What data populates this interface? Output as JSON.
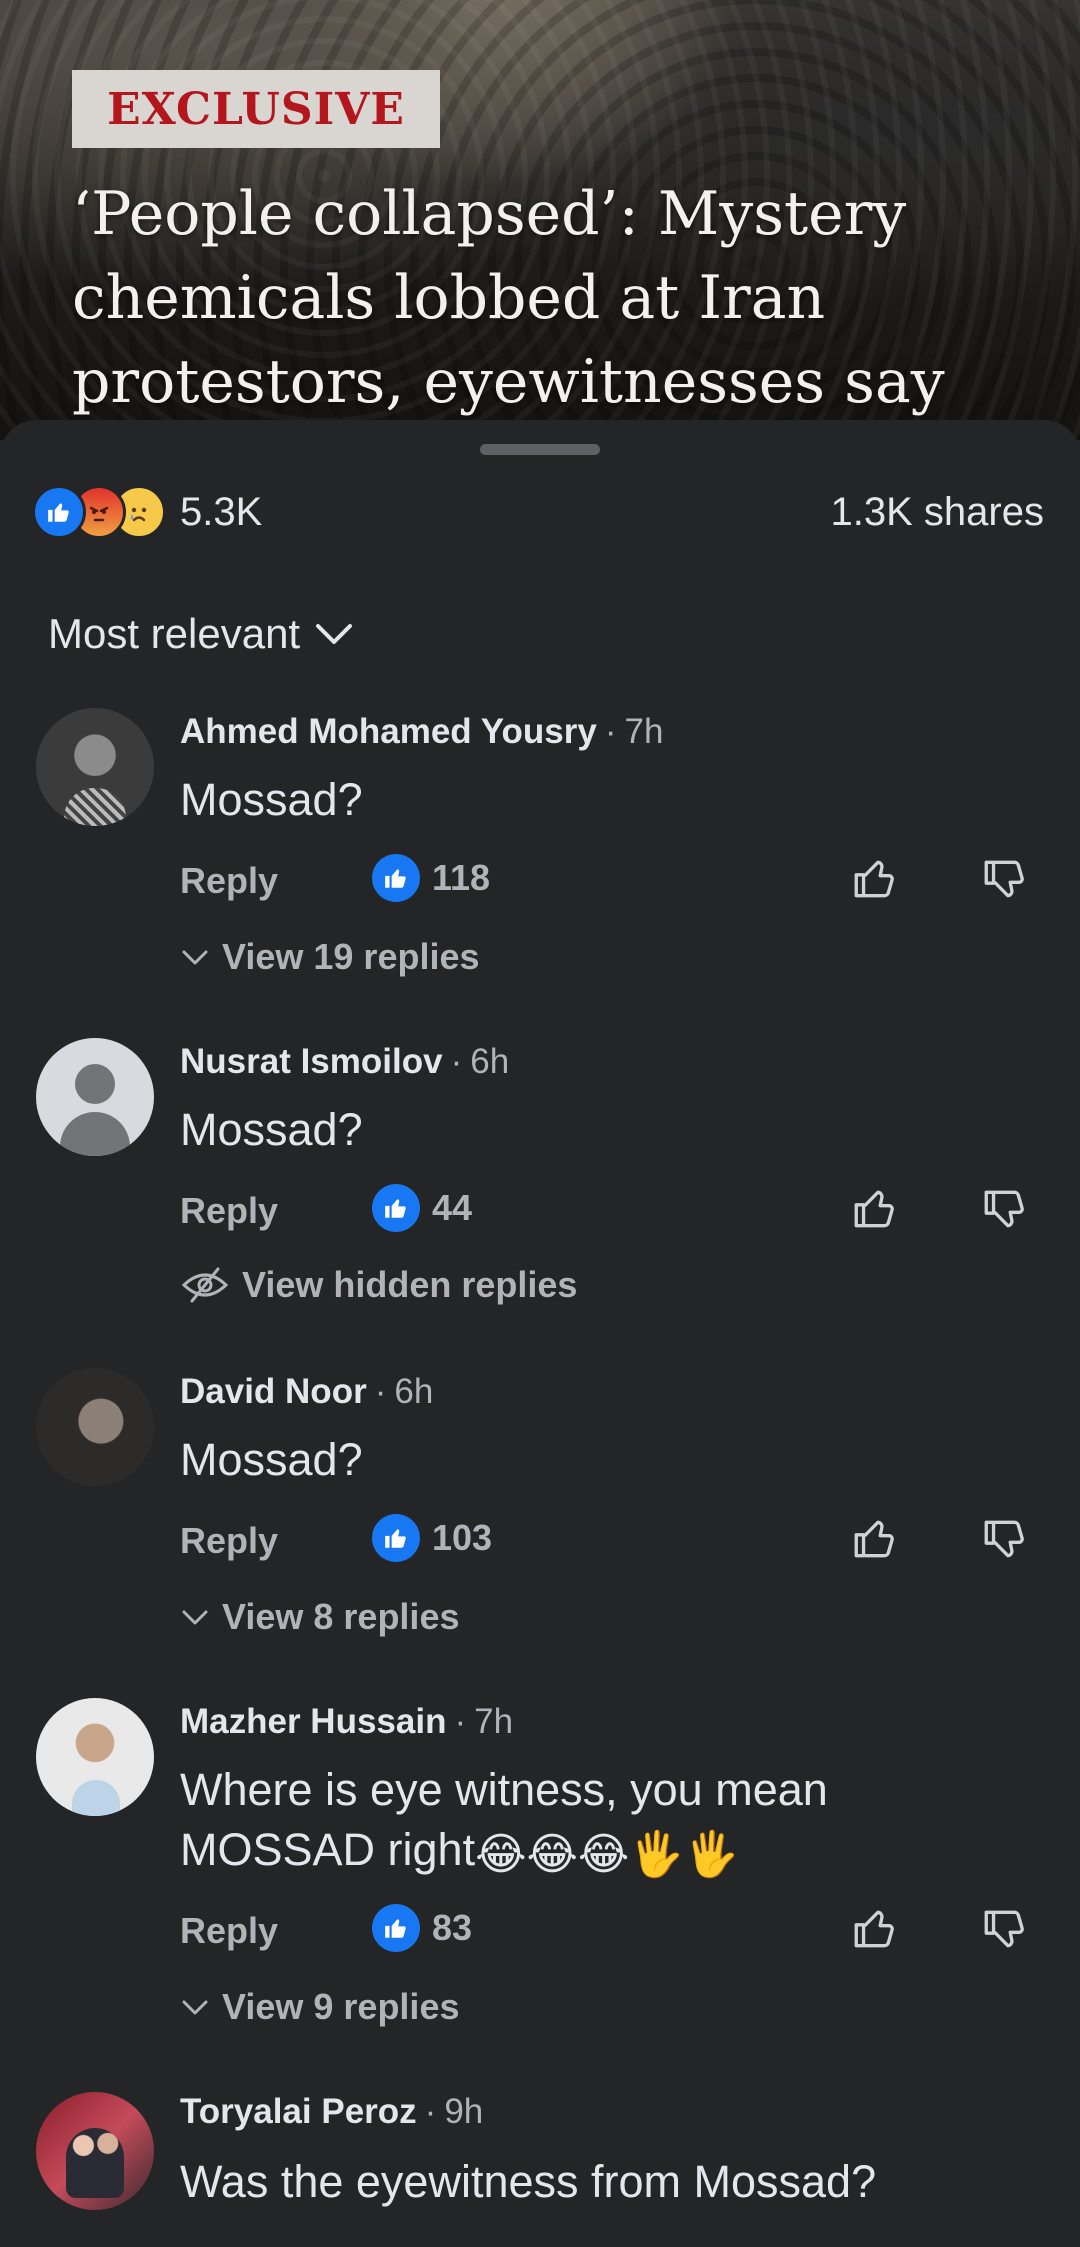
{
  "article": {
    "badge": "EXCLUSIVE",
    "headline": "‘People collapsed’: Mystery chemicals lobbed at Iran protestors, eyewitnesses say"
  },
  "stats": {
    "reaction_count": "5.3K",
    "shares": "1.3K shares",
    "reaction_icons": [
      "like-icon",
      "angry-icon",
      "sad-icon"
    ]
  },
  "sort": {
    "label": "Most relevant"
  },
  "actions": {
    "reply": "Reply"
  },
  "comments": [
    {
      "name": "Ahmed Mohamed Yousry",
      "time": "7h",
      "text": "Mossad?",
      "likes": "118",
      "replies_label": "View 19 replies"
    },
    {
      "name": "Nusrat Ismoilov",
      "time": "6h",
      "text": "Mossad?",
      "likes": "44",
      "replies_label": "View hidden replies"
    },
    {
      "name": "David Noor",
      "time": "6h",
      "text": "Mossad?",
      "likes": "103",
      "replies_label": "View 8 replies"
    },
    {
      "name": "Mazher Hussain",
      "time": "7h",
      "text_line1": "Where is eye witness, you mean",
      "text_line2": "MOSSAD right",
      "emojis": "😂😂😂🖐🖐",
      "likes": "83",
      "replies_label": "View 9 replies"
    },
    {
      "name": "Toryalai Peroz",
      "time": "9h",
      "text": "Was the eyewitness from Mossad?"
    }
  ],
  "colors": {
    "background": "#242527",
    "accent": "#1877f2",
    "secondary_text": "#b0b3b8",
    "badge_text": "#b3161d"
  }
}
